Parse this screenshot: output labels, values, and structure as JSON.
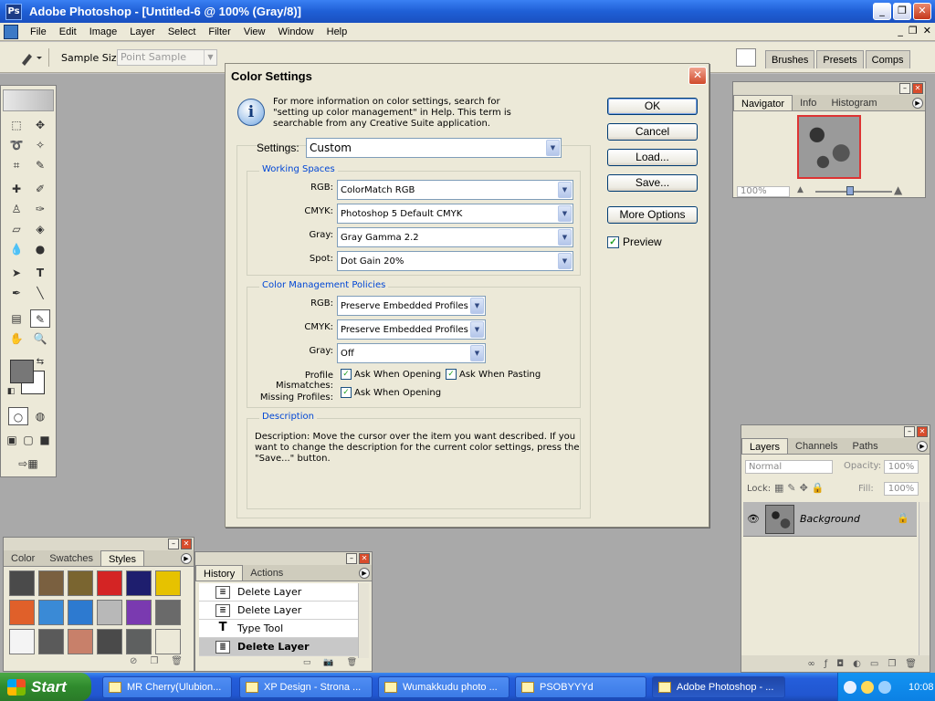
{
  "window": {
    "title": "Adobe Photoshop - [Untitled-6 @ 100% (Gray/8)]",
    "btn_min": "_",
    "btn_max": "❐",
    "btn_close": "✕"
  },
  "menu": [
    "File",
    "Edit",
    "Image",
    "Layer",
    "Select",
    "Filter",
    "View",
    "Window",
    "Help"
  ],
  "doc_btns": [
    "_",
    "❐",
    "✕"
  ],
  "options": {
    "sample_label": "Sample Size:",
    "sample_value": "Point Sample"
  },
  "palette_well_tabs": [
    "Brushes",
    "Presets",
    "Comps"
  ],
  "navigator": {
    "tabs": [
      "Navigator",
      "Info",
      "Histogram"
    ],
    "zoom": "100%"
  },
  "layers": {
    "tabs": [
      "Layers",
      "Channels",
      "Paths"
    ],
    "blend_mode": "Normal",
    "opacity_label": "Opacity:",
    "opacity_value": "100%",
    "lock_label": "Lock:",
    "fill_label": "Fill:",
    "fill_value": "100%",
    "layer_name": "Background"
  },
  "styles": {
    "tabs": [
      "Color",
      "Swatches",
      "Styles"
    ],
    "swatches": [
      "#4a4a4a",
      "#7a6040",
      "#7a6530",
      "#d42424",
      "#1e1e6e",
      "#e6c200",
      "#e0602a",
      "#3a8ad6",
      "#2d7ad0",
      "#b8b8b8",
      "#7a3ab0",
      "#6a6a6a",
      "#f4f4f4",
      "#5a5a5a",
      "#c8806a",
      "#4a4a4a",
      "#5e6060",
      "#ece9d8"
    ]
  },
  "history": {
    "tabs": [
      "History",
      "Actions"
    ],
    "items": [
      {
        "label": "Delete Layer",
        "current": false
      },
      {
        "label": "Delete Layer",
        "current": false
      },
      {
        "label": "Type Tool",
        "current": false
      },
      {
        "label": "Delete Layer",
        "current": true
      }
    ]
  },
  "dialog": {
    "title": "Color Settings",
    "info_text": "For more information on color settings, search for \"setting up color management\" in Help. This term is searchable from any Creative Suite application.",
    "buttons": {
      "ok": "OK",
      "cancel": "Cancel",
      "load": "Load...",
      "save": "Save...",
      "more_options": "More Options"
    },
    "preview_label": "Preview",
    "preview_checked": true,
    "settings_label": "Settings:",
    "settings_value": "Custom",
    "working_spaces": {
      "legend": "Working Spaces",
      "rgb_label": "RGB:",
      "rgb_value": "ColorMatch RGB",
      "cmyk_label": "CMYK:",
      "cmyk_value": "Photoshop 5 Default CMYK",
      "gray_label": "Gray:",
      "gray_value": "Gray Gamma 2.2",
      "spot_label": "Spot:",
      "spot_value": "Dot Gain 20%"
    },
    "policies": {
      "legend": "Color Management Policies",
      "rgb_label": "RGB:",
      "rgb_value": "Preserve Embedded Profiles",
      "cmyk_label": "CMYK:",
      "cmyk_value": "Preserve Embedded Profiles",
      "gray_label": "Gray:",
      "gray_value": "Off",
      "mismatch_label": "Profile Mismatches:",
      "ask_opening": "Ask When Opening",
      "ask_pasting": "Ask When Pasting",
      "missing_label": "Missing Profiles:",
      "missing_ask_opening": "Ask When Opening"
    },
    "description": {
      "legend": "Description",
      "text": "Description:  Move the cursor over the item you want described.  If you want to change the description for the current color settings, press the \"Save...\" button."
    }
  },
  "taskbar": {
    "start": "Start",
    "tasks": [
      {
        "label": "MR Cherry(Ulubion...",
        "active": false
      },
      {
        "label": "XP Design - Strona ...",
        "active": false
      },
      {
        "label": "Wumakkudu photo ...",
        "active": false
      },
      {
        "label": "PSOBYYYd",
        "active": false
      },
      {
        "label": "Adobe Photoshop - ...",
        "active": true
      }
    ],
    "clock": "10:08"
  }
}
